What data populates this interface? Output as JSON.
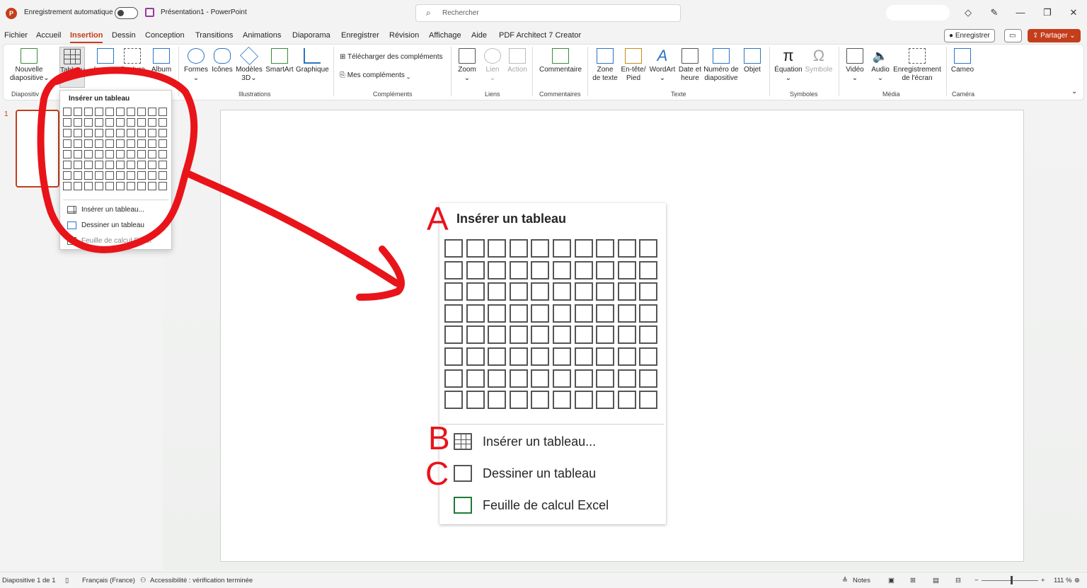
{
  "titlebar": {
    "autosave_label": "Enregistrement automatique",
    "doc_title": "Présentation1 - PowerPoint",
    "search_placeholder": "Rechercher",
    "minimize": "—",
    "restore": "❐",
    "close": "✕"
  },
  "tabs": [
    "Fichier",
    "Accueil",
    "Insertion",
    "Dessin",
    "Conception",
    "Transitions",
    "Animations",
    "Diaporama",
    "Enregistrer",
    "Révision",
    "Affichage",
    "Aide",
    "PDF Architect 7 Creator"
  ],
  "active_tab": "Insertion",
  "right_buttons": {
    "record": "Enregistrer",
    "share": "Partager"
  },
  "ribbon": {
    "buttons": {
      "nouvelle": "Nouvelle",
      "diapositive": "diapositive",
      "tableau": "Tableau",
      "images": "Images",
      "capture": "Capture",
      "album": "Album",
      "formes": "Formes",
      "icones": "Icônes",
      "modeles": "Modèles",
      "modeles2": "3D",
      "smartart": "SmartArt",
      "graphique": "Graphique",
      "telecharger": "Télécharger des compléments",
      "mes": "Mes compléments",
      "zoom": "Zoom",
      "lien": "Lien",
      "action": "Action",
      "commentaire": "Commentaire",
      "zone": "Zone",
      "zone2": "de texte",
      "entete": "En-tête/",
      "entete2": "Pied",
      "wordart": "WordArt",
      "date": "Date et",
      "date2": "heure",
      "numero": "Numéro de",
      "numero2": "diapositive",
      "objet": "Objet",
      "equation": "Équation",
      "symbole": "Symbole",
      "video": "Vidéo",
      "audio": "Audio",
      "enreg": "Enregistrement",
      "enreg2": "de l'écran",
      "cameo": "Cameo"
    },
    "groups": {
      "diapositives": "Diapositiv",
      "illustrations": "Illustrations",
      "complements": "Compléments",
      "liens": "Liens",
      "commentaires": "Commentaires",
      "texte": "Texte",
      "symboles": "Symboles",
      "media": "Média",
      "camera": "Caméra"
    }
  },
  "slide_panel": {
    "number": "1"
  },
  "dropdown": {
    "header": "Insérer un tableau",
    "items": [
      "Insérer un tableau...",
      "Dessiner un tableau",
      "Feuille de calcul Excel"
    ]
  },
  "zoomed": {
    "header": "Insérer un tableau",
    "items": [
      "Insérer un tableau...",
      "Dessiner un tableau",
      "Feuille de calcul Excel"
    ],
    "letters": [
      "A",
      "B",
      "C"
    ]
  },
  "grid": {
    "cols": 10,
    "rows": 8
  },
  "statusbar": {
    "slide": "Diapositive 1 de 1",
    "lang": "Français (France)",
    "access": "Accessibilité : vérification terminée",
    "notes": "Notes",
    "zoom": "111 %"
  },
  "colors": {
    "accent": "#c43e1c",
    "annotation": "#e8141a"
  }
}
